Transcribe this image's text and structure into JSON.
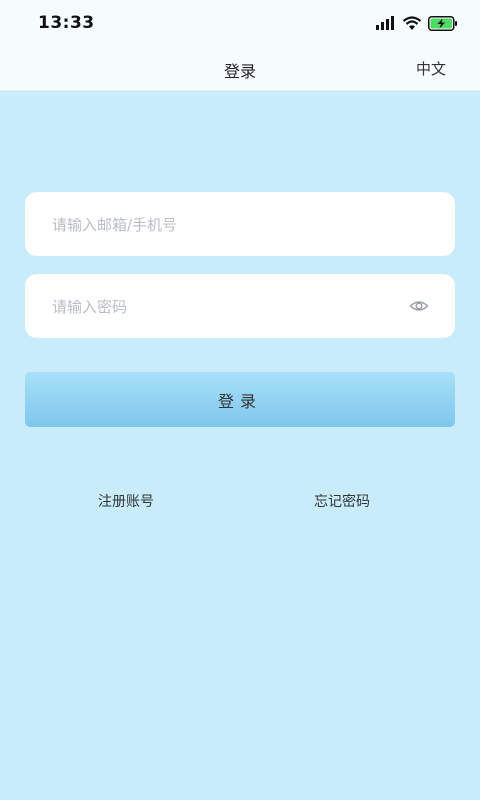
{
  "status_bar": {
    "time": "13:33",
    "icons": [
      "signal-icon",
      "wifi-icon",
      "battery-charging-icon"
    ]
  },
  "header": {
    "title": "登录",
    "language": "中文"
  },
  "form": {
    "account_placeholder": "请输入邮箱/手机号",
    "password_placeholder": "请输入密码",
    "login_label": "登录",
    "password_toggle_icon": "eye-icon"
  },
  "links": {
    "register": "注册账号",
    "forgot": "忘记密码"
  },
  "colors": {
    "background": "#c9ecfb",
    "button_top": "#a8e0f8",
    "button_bottom": "#7fc6ee",
    "battery_fill": "#4cd964"
  }
}
